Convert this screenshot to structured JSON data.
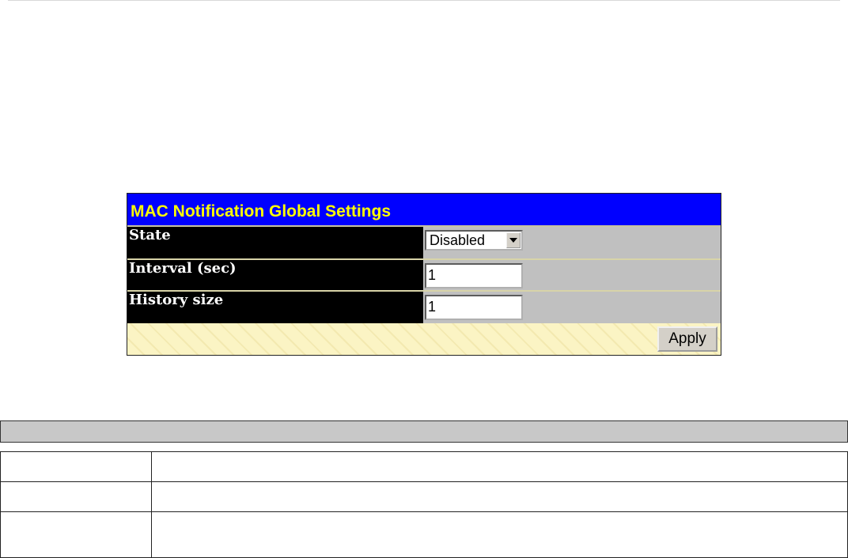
{
  "panel": {
    "title": "MAC Notification Global Settings",
    "rows": [
      {
        "label": "State",
        "control": "select",
        "value": "Disabled"
      },
      {
        "label": "Interval (sec)",
        "control": "text",
        "value": "1"
      },
      {
        "label": "History size",
        "control": "text",
        "value": "1"
      }
    ],
    "apply_label": "Apply"
  },
  "description_table": {
    "rows": [
      {
        "name": "",
        "description": ""
      },
      {
        "name": "",
        "description": ""
      },
      {
        "name": "",
        "description": ""
      }
    ]
  }
}
